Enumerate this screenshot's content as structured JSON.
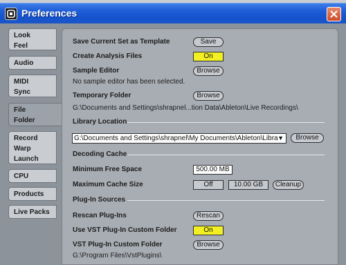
{
  "window": {
    "title": "Preferences",
    "accent_color": "#1f5fd8",
    "close_icon": "close-icon",
    "app_icon": "ableton-logo-icon"
  },
  "sidebar": {
    "tabs": [
      {
        "lines": [
          "Look",
          "Feel"
        ],
        "active": false
      },
      {
        "lines": [
          "Audio"
        ],
        "active": false
      },
      {
        "lines": [
          "MIDI",
          "Sync"
        ],
        "active": false
      },
      {
        "lines": [
          "File",
          "Folder"
        ],
        "active": true
      },
      {
        "lines": [
          "Record",
          "Warp",
          "Launch"
        ],
        "active": false
      },
      {
        "lines": [
          "CPU"
        ],
        "active": false
      },
      {
        "lines": [
          "Products"
        ],
        "active": false
      },
      {
        "lines": [
          "Live Packs"
        ],
        "active": false
      }
    ]
  },
  "content": {
    "save_template": {
      "label": "Save Current Set as Template",
      "button": "Save"
    },
    "analysis": {
      "label": "Create Analysis Files",
      "value": "On"
    },
    "sample_editor": {
      "label": "Sample Editor",
      "button": "Browse",
      "status": "No sample editor has been selected."
    },
    "temp_folder": {
      "label": "Temporary Folder",
      "button": "Browse",
      "path": "G:\\Documents and Settings\\shrapnel...tion Data\\Ableton\\Live Recordings\\"
    },
    "library": {
      "section": "Library Location",
      "path": "G:\\Documents and Settings\\shrapnel\\My Documents\\Ableton\\Libra",
      "button": "Browse"
    },
    "cache": {
      "section": "Decoding Cache",
      "min_free_label": "Minimum Free Space",
      "min_free_value": "500.00 MB",
      "max_size_label": "Maximum Cache Size",
      "max_toggle": "Off",
      "max_value": "10.00 GB",
      "cleanup": "Cleanup"
    },
    "plugins": {
      "section": "Plug-In Sources",
      "rescan_label": "Rescan Plug-Ins",
      "rescan_button": "Rescan",
      "use_vst_label": "Use VST Plug-In Custom Folder",
      "use_vst_value": "On",
      "vst_folder_label": "VST Plug-In Custom Folder",
      "vst_folder_button": "Browse",
      "vst_folder_path": "G:\\Program Files\\VstPlugins\\"
    }
  }
}
